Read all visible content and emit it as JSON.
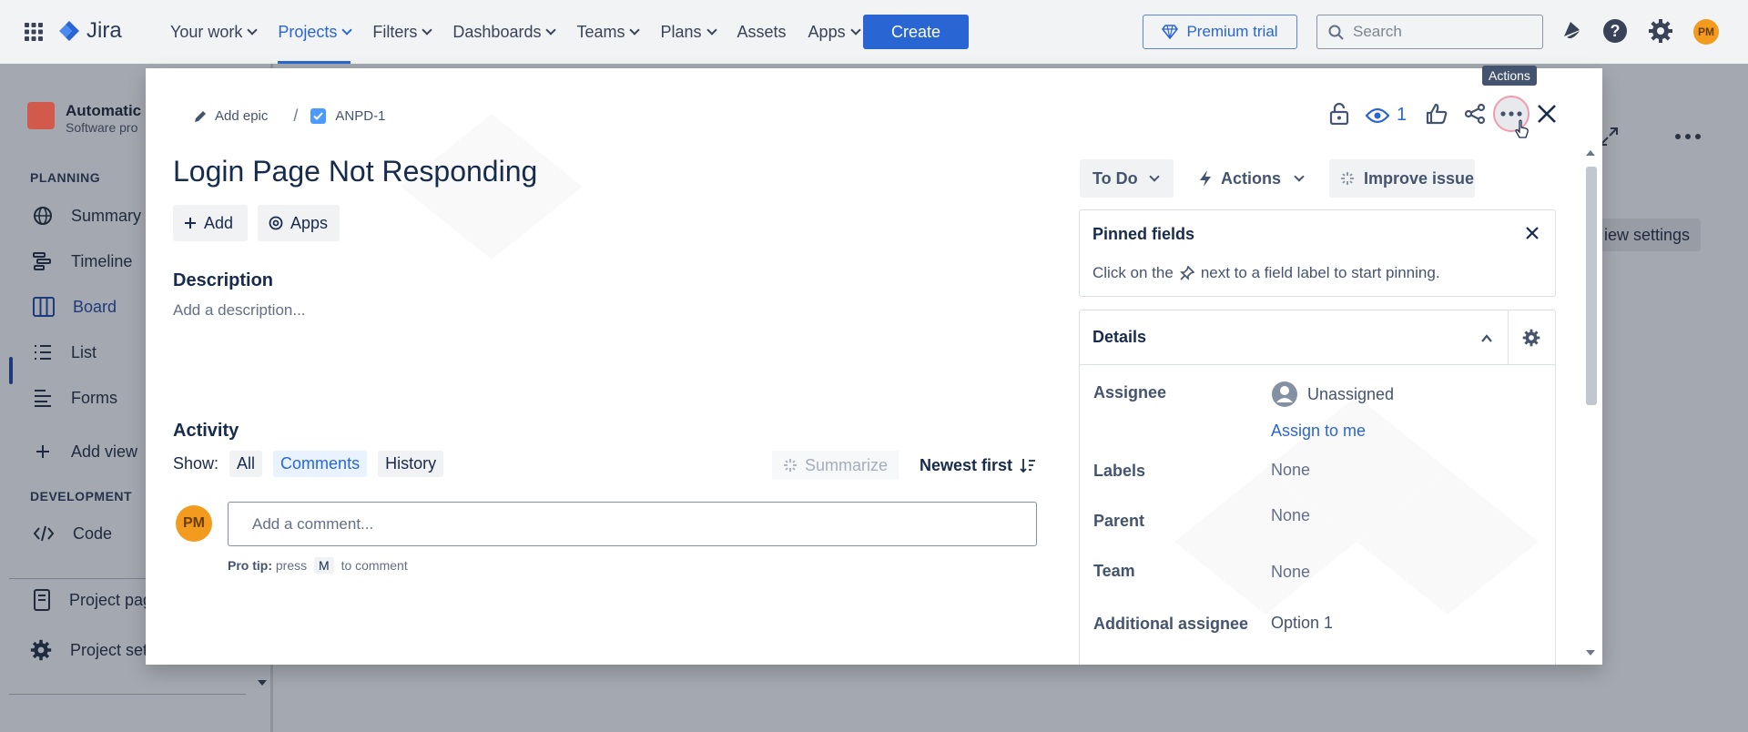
{
  "nav": {
    "logo": "Jira",
    "menu": [
      {
        "label": "Your work"
      },
      {
        "label": "Projects"
      },
      {
        "label": "Filters"
      },
      {
        "label": "Dashboards"
      },
      {
        "label": "Teams"
      },
      {
        "label": "Plans"
      },
      {
        "label": "Assets"
      },
      {
        "label": "Apps"
      }
    ],
    "create": "Create",
    "premium": "Premium trial",
    "search_placeholder": "Search",
    "avatar": "PM",
    "accent": "#2a66d3"
  },
  "sidebar": {
    "project_name": "Automatic",
    "project_type": "Software pro",
    "planning": "PLANNING",
    "items": [
      "Summary",
      "Timeline",
      "Board",
      "List",
      "Forms"
    ],
    "add_view": "Add view",
    "development": "DEVELOPMENT",
    "code": "Code",
    "project_pages": "Project pag",
    "project_settings": "Project sett"
  },
  "background": {
    "view_settings": "iew settings"
  },
  "modal": {
    "add_epic": "Add epic",
    "issue_key": "ANPD-1",
    "watch_count": "1",
    "tooltip": "Actions",
    "title": "Login Page Not Responding",
    "add": "Add",
    "apps": "Apps",
    "description_heading": "Description",
    "description_placeholder": "Add a description...",
    "activity_heading": "Activity",
    "show_label": "Show:",
    "filters": [
      "All",
      "Comments",
      "History"
    ],
    "summarize": "Summarize",
    "sort": "Newest first",
    "comment_avatar": "PM",
    "comment_placeholder": "Add a comment...",
    "protip_label": "Pro tip:",
    "protip_press": "press",
    "protip_key": "M",
    "protip_rest": "to comment",
    "status": "To Do",
    "actions": "Actions",
    "improve": "Improve issue",
    "pinned_title": "Pinned fields",
    "pinned_text_before": "Click on the",
    "pinned_text_after": "next to a field label to start pinning.",
    "details_title": "Details",
    "fields": {
      "assignee_label": "Assignee",
      "assignee_value": "Unassigned",
      "assign_to_me": "Assign to me",
      "labels_label": "Labels",
      "labels_value": "None",
      "parent_label": "Parent",
      "parent_value": "None",
      "team_label": "Team",
      "team_value": "None",
      "additional_label": "Additional assignee",
      "additional_value": "Option 1"
    }
  }
}
